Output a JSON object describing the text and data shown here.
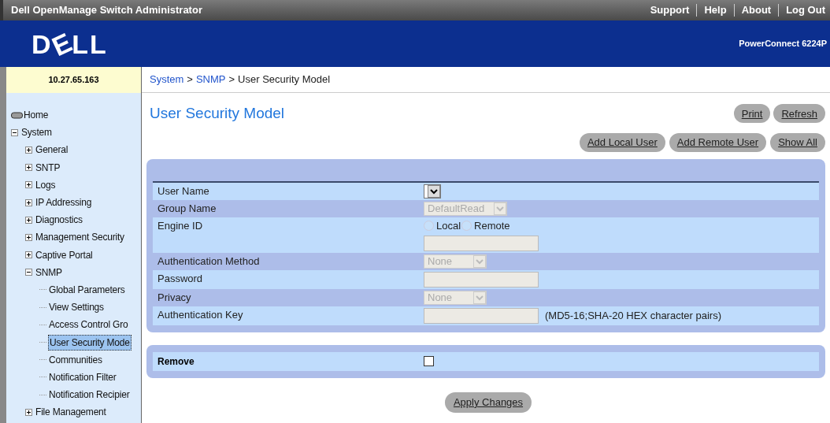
{
  "header": {
    "title": "Dell OpenManage Switch Administrator",
    "links": [
      "Support",
      "Help",
      "About",
      "Log Out"
    ]
  },
  "banner": {
    "logo": "DELL",
    "model": "PowerConnect 6224P"
  },
  "ip_address": "10.27.65.163",
  "breadcrumb": [
    {
      "label": "System",
      "kind": "link"
    },
    {
      "label": ">",
      "kind": "separator"
    },
    {
      "label": "SNMP",
      "kind": "link"
    },
    {
      "label": ">",
      "kind": "separator"
    },
    {
      "label": "User Security Model",
      "kind": "current"
    }
  ],
  "sidebar": {
    "items": [
      {
        "label": "Home",
        "kind": "root",
        "selected": false
      },
      {
        "label": "System",
        "kind": "folder",
        "expanded": true,
        "selected": false,
        "children": [
          {
            "label": "General",
            "kind": "folder",
            "expanded": false,
            "selected": false
          },
          {
            "label": "SNTP",
            "kind": "folder",
            "expanded": false,
            "selected": false
          },
          {
            "label": "Logs",
            "kind": "folder",
            "expanded": false,
            "selected": false
          },
          {
            "label": "IP Addressing",
            "kind": "folder",
            "expanded": false,
            "selected": false
          },
          {
            "label": "Diagnostics",
            "kind": "folder",
            "expanded": false,
            "selected": false
          },
          {
            "label": "Management Security",
            "kind": "folder",
            "expanded": false,
            "selected": false
          },
          {
            "label": "Captive Portal",
            "kind": "folder",
            "expanded": false,
            "selected": false
          },
          {
            "label": "SNMP",
            "kind": "folder",
            "expanded": true,
            "selected": false,
            "children": [
              {
                "label": "Global Parameters",
                "kind": "page",
                "selected": false
              },
              {
                "label": "View Settings",
                "kind": "page",
                "selected": false
              },
              {
                "label": "Access Control Gro",
                "kind": "page",
                "selected": false
              },
              {
                "label": "User Security Mode",
                "kind": "page",
                "selected": true
              },
              {
                "label": "Communities",
                "kind": "page",
                "selected": false
              },
              {
                "label": "Notification Filter",
                "kind": "page",
                "selected": false
              },
              {
                "label": "Notification Recipier",
                "kind": "page",
                "selected": false
              }
            ]
          },
          {
            "label": "File Management",
            "kind": "folder",
            "expanded": false,
            "selected": false
          }
        ]
      }
    ]
  },
  "page": {
    "title": "User Security Model",
    "top_buttons": [
      "Print",
      "Refresh"
    ],
    "action_buttons": [
      "Add Local User",
      "Add Remote User",
      "Show All"
    ]
  },
  "form": {
    "rows": [
      {
        "label": "User Name",
        "kind": "select",
        "value": "",
        "disabled": false
      },
      {
        "label": "Group Name",
        "kind": "select",
        "value": "DefaultRead",
        "disabled": true
      },
      {
        "label": "Engine ID",
        "kind": "radio-input",
        "disabled": true,
        "options": [
          {
            "label": "Local",
            "checked": false
          },
          {
            "label": "Remote",
            "checked": false
          }
        ]
      },
      {
        "label": "Authentication Method",
        "kind": "select",
        "value": "None",
        "disabled": true
      },
      {
        "label": "Password",
        "kind": "input",
        "disabled": true
      },
      {
        "label": "Privacy",
        "kind": "select",
        "value": "None",
        "disabled": true
      },
      {
        "label": "Authentication Key",
        "kind": "input",
        "disabled": true,
        "note": "(MD5-16;SHA-20 HEX character pairs)"
      }
    ]
  },
  "remove": {
    "label": "Remove",
    "checked": false
  },
  "apply_button": "Apply Changes"
}
